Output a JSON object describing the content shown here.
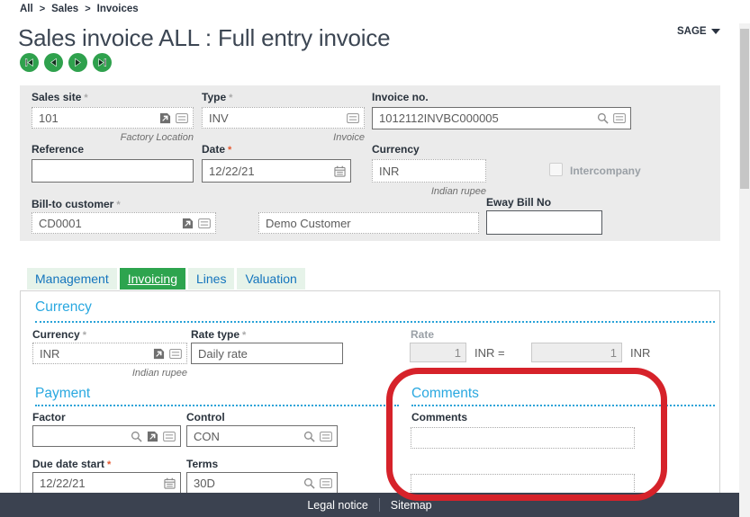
{
  "breadcrumb": {
    "item1": "All",
    "item2": "Sales",
    "item3": "Invoices",
    "separator": ">"
  },
  "header": {
    "title": "Sales invoice ALL : Full entry invoice",
    "user_menu_label": "SAGE"
  },
  "icons": {
    "record_nav": [
      "first-record",
      "previous-record",
      "next-record",
      "last-record"
    ],
    "field_icons": {
      "jump": "jump-to-record",
      "list": "selection-list",
      "search": "magnifier",
      "calendar": "calendar"
    },
    "user_menu": "caret-down"
  },
  "identity_panel": {
    "sales_site": {
      "label": "Sales site",
      "required_marker": "*",
      "value": "101",
      "helper": "Factory Location"
    },
    "type": {
      "label": "Type",
      "required_marker": "*",
      "value": "INV",
      "helper": "Invoice"
    },
    "invoice_no": {
      "label": "Invoice no.",
      "value": "1012112INVBC000005"
    },
    "reference": {
      "label": "Reference",
      "value": ""
    },
    "date": {
      "label": "Date",
      "required_marker": "*",
      "value": "12/22/21"
    },
    "currency": {
      "label": "Currency",
      "value": "INR",
      "helper": "Indian rupee"
    },
    "intercompany": {
      "label": "Intercompany"
    },
    "bill_to_customer": {
      "label": "Bill-to customer",
      "required_marker": "*",
      "value": "CD0001"
    },
    "customer_name": {
      "value": "Demo Customer"
    },
    "eway_bill_no": {
      "label": "Eway Bill No",
      "value": ""
    }
  },
  "tabs": {
    "management": "Management",
    "invoicing": "Invoicing",
    "lines": "Lines",
    "valuation": "Valuation"
  },
  "currency_section": {
    "heading": "Currency",
    "currency": {
      "label": "Currency",
      "required_marker": "*",
      "value": "INR",
      "helper": "Indian rupee"
    },
    "rate_type": {
      "label": "Rate type",
      "required_marker": "*",
      "value": "Daily rate"
    },
    "rate": {
      "label": "Rate",
      "from_value": "1",
      "equals_label": "INR =",
      "to_value": "1",
      "to_unit": "INR"
    }
  },
  "payment_section": {
    "heading": "Payment",
    "factor": {
      "label": "Factor",
      "value": ""
    },
    "control": {
      "label": "Control",
      "value": "CON"
    },
    "due_date_start": {
      "label": "Due date start",
      "required_marker": "*",
      "value": "12/22/21"
    },
    "terms": {
      "label": "Terms",
      "value": "30D"
    }
  },
  "comments_section": {
    "heading": "Comments",
    "comments_label": "Comments"
  },
  "footer": {
    "legal_notice": "Legal notice",
    "sitemap": "Sitemap"
  },
  "colors": {
    "accent_green": "#2fa14d",
    "tab_active_green": "#2da44e",
    "tab_text_blue": "#1374bd",
    "section_heading_blue": "#29a8e0",
    "required_red": "#e4572e",
    "annotation_red": "#d6222a",
    "footer_bg": "#3b4250",
    "panel_gray": "#ebebeb"
  }
}
